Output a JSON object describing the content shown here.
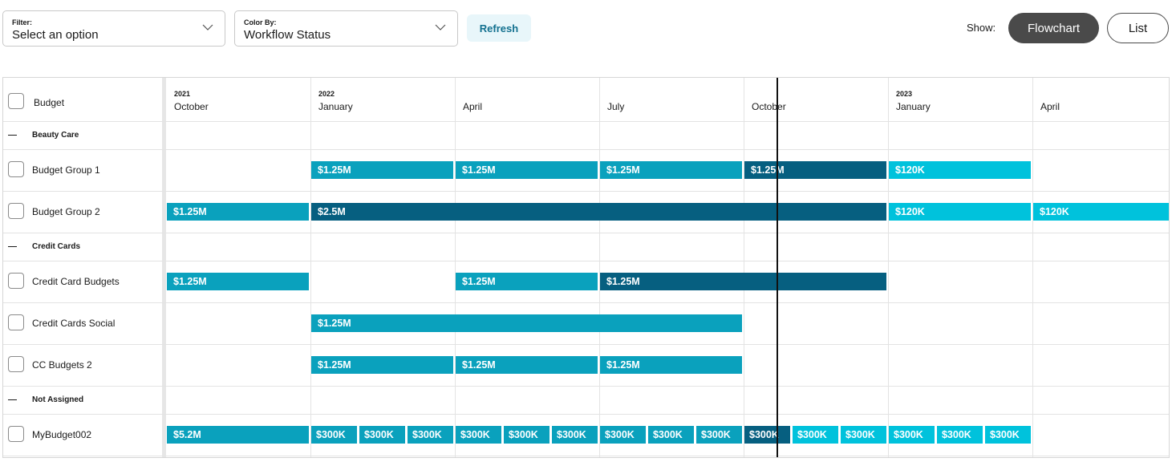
{
  "toolbar": {
    "filter": {
      "label": "Filter:",
      "value": "Select an option"
    },
    "color_by": {
      "label": "Color By:",
      "value": "Workflow Status"
    },
    "refresh_label": "Refresh",
    "show_label": "Show:",
    "view_options": [
      {
        "label": "Flowchart",
        "active": true
      },
      {
        "label": "List",
        "active": false
      }
    ]
  },
  "colors": {
    "teal": "#0aa1bd",
    "dark_teal": "#065f80",
    "light_cyan": "#00c2dc"
  },
  "timeline": {
    "first_column_label": "Budget",
    "columns": [
      {
        "year": "2021",
        "month": "October"
      },
      {
        "year": "2022",
        "month": "January"
      },
      {
        "year": "",
        "month": "April"
      },
      {
        "year": "",
        "month": "July"
      },
      {
        "year": "",
        "month": "October"
      },
      {
        "year": "2023",
        "month": "January"
      },
      {
        "year": "",
        "month": "April"
      }
    ],
    "rows": [
      {
        "type": "group",
        "label": "Beauty Care"
      },
      {
        "type": "item",
        "label": "Budget Group 1"
      },
      {
        "type": "item",
        "label": "Budget Group 2"
      },
      {
        "type": "group",
        "label": "Credit Cards"
      },
      {
        "type": "item",
        "label": "Credit Card Budgets"
      },
      {
        "type": "item",
        "label": "Credit Cards Social"
      },
      {
        "type": "item",
        "label": "CC Budgets 2"
      },
      {
        "type": "group",
        "label": "Not Assigned"
      },
      {
        "type": "item",
        "label": "MyBudget002"
      }
    ],
    "bars": [
      {
        "row": "Budget Group 1",
        "label": "$1.25M",
        "start": 1,
        "span": 1,
        "color": "teal"
      },
      {
        "row": "Budget Group 1",
        "label": "$1.25M",
        "start": 2,
        "span": 1,
        "color": "teal"
      },
      {
        "row": "Budget Group 1",
        "label": "$1.25M",
        "start": 3,
        "span": 1,
        "color": "teal"
      },
      {
        "row": "Budget Group 1",
        "label": "$1.25M",
        "start": 4,
        "span": 1,
        "color": "dark_teal"
      },
      {
        "row": "Budget Group 1",
        "label": "$120K",
        "start": 5,
        "span": 1,
        "color": "light_cyan"
      },
      {
        "row": "Budget Group 2",
        "label": "$1.25M",
        "start": 0,
        "span": 1,
        "color": "teal"
      },
      {
        "row": "Budget Group 2",
        "label": "$2.5M",
        "start": 1,
        "span": 4,
        "color": "dark_teal"
      },
      {
        "row": "Budget Group 2",
        "label": "$120K",
        "start": 5,
        "span": 1,
        "color": "light_cyan"
      },
      {
        "row": "Budget Group 2",
        "label": "$120K",
        "start": 6,
        "span": 1,
        "color": "light_cyan"
      },
      {
        "row": "Credit Card Budgets",
        "label": "$1.25M",
        "start": 0,
        "span": 1,
        "color": "teal"
      },
      {
        "row": "Credit Card Budgets",
        "label": "$1.25M",
        "start": 2,
        "span": 1,
        "color": "teal"
      },
      {
        "row": "Credit Card Budgets",
        "label": "$1.25M",
        "start": 3,
        "span": 2,
        "color": "dark_teal"
      },
      {
        "row": "Credit Cards Social",
        "label": "$1.25M",
        "start": 1,
        "span": 3,
        "color": "teal"
      },
      {
        "row": "CC Budgets 2",
        "label": "$1.25M",
        "start": 1,
        "span": 1,
        "color": "teal"
      },
      {
        "row": "CC Budgets 2",
        "label": "$1.25M",
        "start": 2,
        "span": 1,
        "color": "teal"
      },
      {
        "row": "CC Budgets 2",
        "label": "$1.25M",
        "start": 3,
        "span": 1,
        "color": "teal"
      },
      {
        "row": "MyBudget002",
        "label": "$5.2M",
        "start": 0,
        "span": 1,
        "color": "teal"
      },
      {
        "row": "MyBudget002",
        "label": "$300K",
        "start": 1,
        "span": 0.3333,
        "color": "teal"
      },
      {
        "row": "MyBudget002",
        "label": "$300K",
        "start": 1.3333,
        "span": 0.3333,
        "color": "teal"
      },
      {
        "row": "MyBudget002",
        "label": "$300K",
        "start": 1.6667,
        "span": 0.3333,
        "color": "teal"
      },
      {
        "row": "MyBudget002",
        "label": "$300K",
        "start": 2,
        "span": 0.3333,
        "color": "teal"
      },
      {
        "row": "MyBudget002",
        "label": "$300K",
        "start": 2.3333,
        "span": 0.3333,
        "color": "teal"
      },
      {
        "row": "MyBudget002",
        "label": "$300K",
        "start": 2.6667,
        "span": 0.3333,
        "color": "teal"
      },
      {
        "row": "MyBudget002",
        "label": "$300K",
        "start": 3,
        "span": 0.3333,
        "color": "teal"
      },
      {
        "row": "MyBudget002",
        "label": "$300K",
        "start": 3.3333,
        "span": 0.3333,
        "color": "teal"
      },
      {
        "row": "MyBudget002",
        "label": "$300K",
        "start": 3.6667,
        "span": 0.3333,
        "color": "teal"
      },
      {
        "row": "MyBudget002",
        "label": "$300K",
        "start": 4,
        "span": 0.3333,
        "color": "dark_teal"
      },
      {
        "row": "MyBudget002",
        "label": "$300K",
        "start": 4.3333,
        "span": 0.3333,
        "color": "light_cyan"
      },
      {
        "row": "MyBudget002",
        "label": "$300K",
        "start": 4.6667,
        "span": 0.3333,
        "color": "light_cyan"
      },
      {
        "row": "MyBudget002",
        "label": "$300K",
        "start": 5,
        "span": 0.3333,
        "color": "light_cyan"
      },
      {
        "row": "MyBudget002",
        "label": "$300K",
        "start": 5.3333,
        "span": 0.3333,
        "color": "light_cyan"
      },
      {
        "row": "MyBudget002",
        "label": "$300K",
        "start": 5.6667,
        "span": 0.3333,
        "color": "light_cyan"
      }
    ]
  }
}
